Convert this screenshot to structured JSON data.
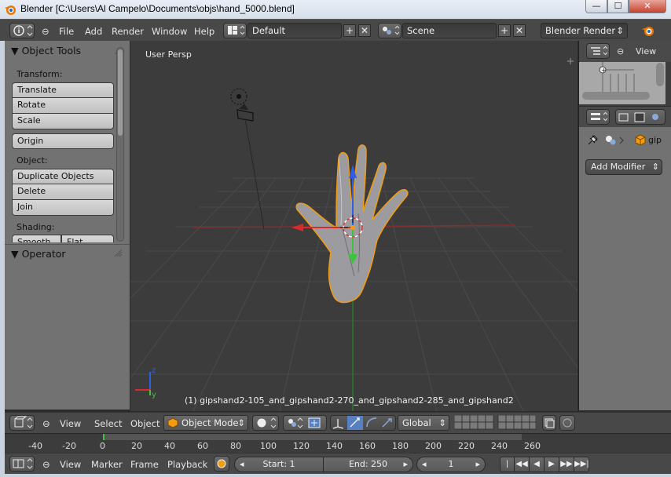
{
  "window": {
    "title": "Blender [C:\\Users\\Al Campelo\\Documents\\objs\\hand_5000.blend]",
    "min_label": "—",
    "max_label": "☐",
    "close_label": "✕"
  },
  "topbar": {
    "menus": [
      "File",
      "Add",
      "Render",
      "Window",
      "Help"
    ],
    "screen_layout": "Default",
    "scene": "Scene",
    "render_engine": "Blender Render"
  },
  "toolshelf": {
    "title": "Object Tools",
    "transform_label": "Transform:",
    "transform_buttons": [
      "Translate",
      "Rotate",
      "Scale"
    ],
    "origin_button": "Origin",
    "object_label": "Object:",
    "object_buttons": [
      "Duplicate Objects",
      "Delete",
      "Join"
    ],
    "shading_label": "Shading:",
    "shading_buttons": [
      "Smooth",
      "Flat"
    ],
    "operator_title": "Operator"
  },
  "viewport": {
    "view_label": "User Persp",
    "object_info": "(1) gipshand2-105_and_gipshand2-270_and_gipshand2-285_and_gipshand2",
    "axis_z": "z",
    "axis_y": "y"
  },
  "outliner": {
    "view_label": "View"
  },
  "properties": {
    "object_name": "gip",
    "add_modifier": "Add Modifier"
  },
  "view3d_header": {
    "menus": [
      "View",
      "Select",
      "Object"
    ],
    "mode": "Object Mode",
    "orientation": "Global"
  },
  "timeline": {
    "ticks": [
      "-40",
      "-20",
      "0",
      "20",
      "40",
      "60",
      "80",
      "100",
      "120",
      "140",
      "160",
      "180",
      "200",
      "220",
      "240",
      "260"
    ],
    "menus": [
      "View",
      "Marker",
      "Frame",
      "Playback"
    ],
    "start": "Start: 1",
    "end": "End: 250",
    "current": "1"
  },
  "colors": {
    "accent": "#5680c2",
    "selection": "#f39c12",
    "x_axis": "#d42c2c",
    "y_axis": "#3cc43c",
    "z_axis": "#2d5fe0"
  }
}
